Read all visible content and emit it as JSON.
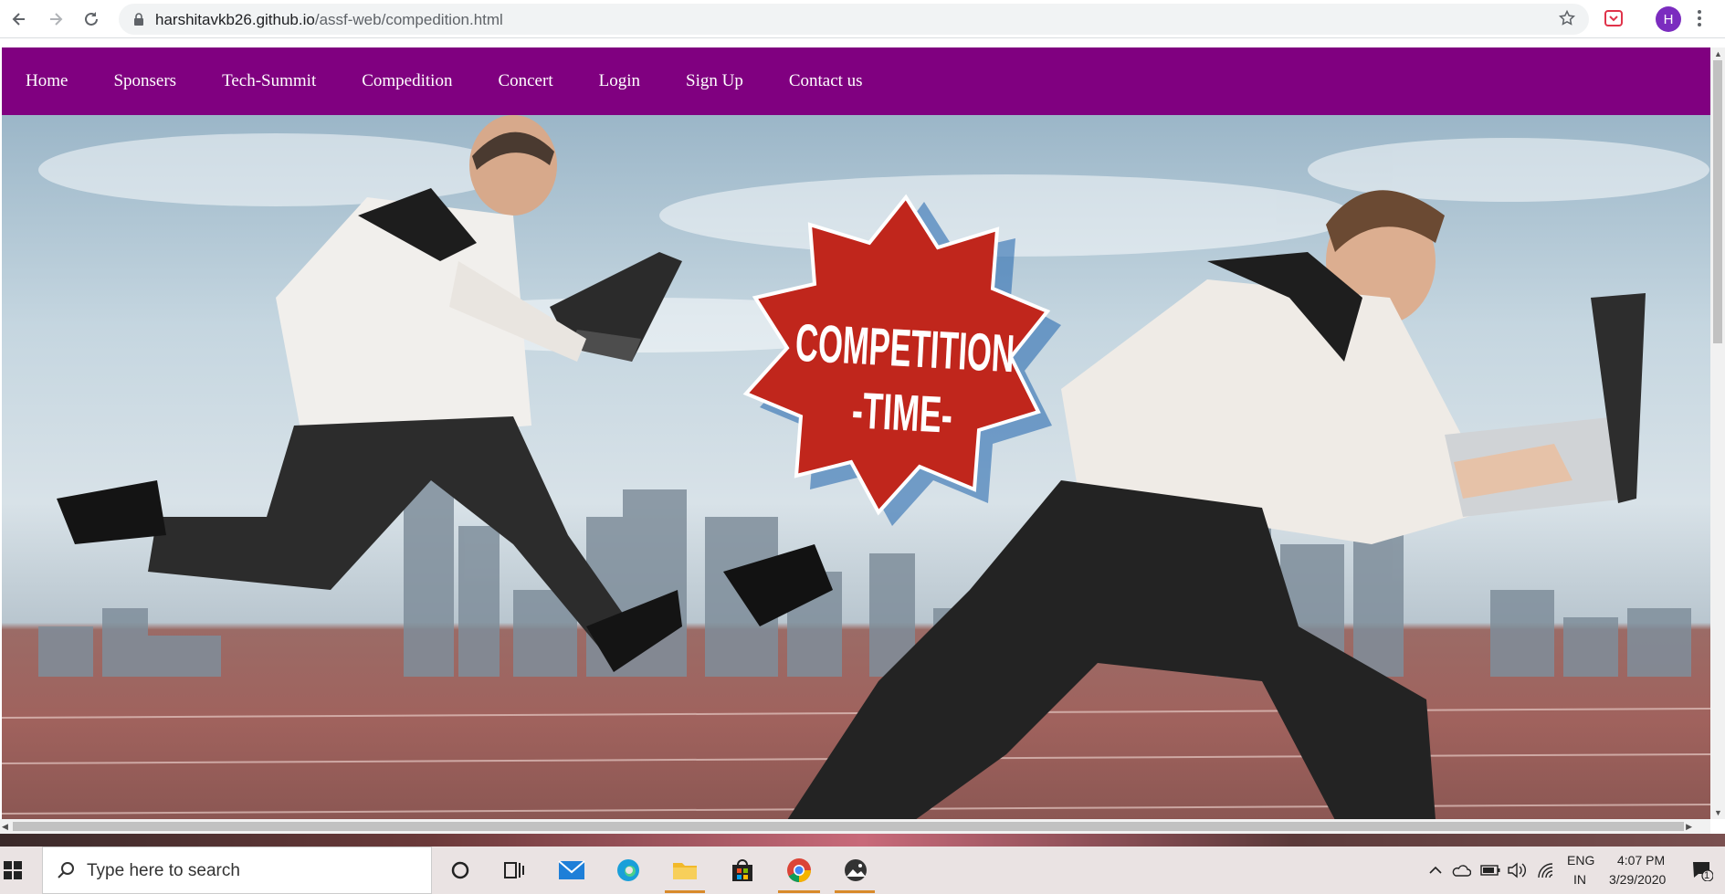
{
  "browser": {
    "url_host": "harshitavkb26.github.io",
    "url_path": "/assf-web/compedition.html",
    "profile_initial": "H"
  },
  "site_nav": {
    "items": [
      "Home",
      "Sponsers",
      "Tech-Summit",
      "Compedition",
      "Concert",
      "Login",
      "Sign Up",
      "Contact us"
    ]
  },
  "hero": {
    "badge_line1": "COMPETITION",
    "badge_line2": "-TIME-"
  },
  "taskbar": {
    "search_placeholder": "Type here to search",
    "language": "ENG",
    "region": "IN",
    "time": "4:07 PM",
    "date": "3/29/2020",
    "notification_count": "1"
  },
  "colors": {
    "nav_bg": "#800080",
    "badge_red": "#c0261c",
    "profile_purple": "#7b2cbf"
  }
}
